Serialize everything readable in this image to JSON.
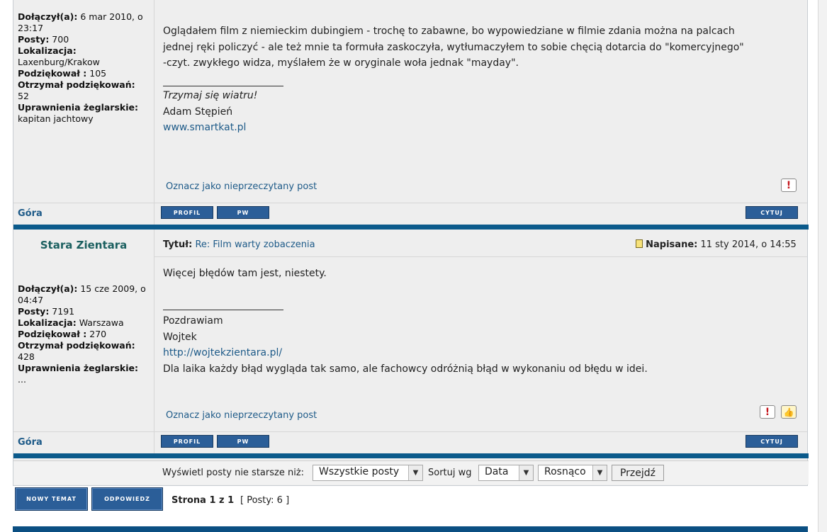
{
  "post1": {
    "profile": {
      "joined_label": "Dołączył(a):",
      "joined_value": "6 mar 2010, o 23:17",
      "posts_label": "Posty:",
      "posts_value": "700",
      "location_label": "Lokalizacja:",
      "location_value": "Laxenburg/Krakow",
      "thanked_label": "Podziękował :",
      "thanked_value": "105",
      "received_label": "Otrzymał podziękowań:",
      "received_value": "52",
      "rights_label": "Uprawnienia żeglarskie:",
      "rights_value": "kapitan jachtowy"
    },
    "body_lines": [
      "Oglądałem film z niemieckim dubingiem - trochę to zabawne, bo wypowiedziane w filmie zdania można na palcach",
      "jednej ręki policzyć - ale też mnie ta formuła zaskoczyła, wytłumaczyłem to sobie chęcią dotarcia do \"komercyjnego\"",
      "-czyt. zwykłego widza, myślałem że w oryginale woła jednak \"mayday\"."
    ],
    "sig_italic": "Trzymaj się wiatru!",
    "sig_name": "Adam Stępień",
    "sig_link": "www.smartkat.pl",
    "mark_unread": "Oznacz jako nieprzeczytany post",
    "top_link": "Góra",
    "btn_profile": "Profil",
    "btn_pm": "PW",
    "btn_quote": "Cytuj"
  },
  "post2": {
    "username": "Stara Zientara",
    "title_label": "Tytuł:",
    "title_value": "Re: Film warty zobaczenia",
    "posted_label": "Napisane:",
    "posted_value": "11 sty 2014, o 14:55",
    "profile": {
      "joined_label": "Dołączył(a):",
      "joined_value": "15 cze 2009, o 04:47",
      "posts_label": "Posty:",
      "posts_value": "7191",
      "location_label": "Lokalizacja:",
      "location_value": "Warszawa",
      "thanked_label": "Podziękował :",
      "thanked_value": "270",
      "received_label": "Otrzymał podziękowań:",
      "received_value": "428",
      "rights_label": "Uprawnienia żeglarskie:",
      "rights_value": "..."
    },
    "body": "Więcej błędów tam jest, niestety.",
    "sig_greet": "Pozdrawiam",
    "sig_name": "Wojtek",
    "sig_link": "http://wojtekzientara.pl/",
    "sig_quote": "Dla laika każdy błąd wygląda tak samo, ale fachowcy odróżnią błąd w wykonaniu od błędu w idei.",
    "mark_unread": "Oznacz jako nieprzeczytany post",
    "top_link": "Góra",
    "btn_profile": "Profil",
    "btn_pm": "PW",
    "btn_quote": "Cytuj"
  },
  "filter": {
    "show_label": "Wyświetl posty nie starsze niż:",
    "show_value": "Wszystkie posty",
    "sort_label": "Sortuj wg",
    "sort_value": "Data",
    "order_value": "Rosnąco",
    "go_label": "Przejdź"
  },
  "footer": {
    "new_topic": "Nowy temat",
    "reply": "Odpowiedz",
    "page_info": "Strona 1 z 1",
    "posts_info": "[ Posty: 6 ]"
  },
  "icons": {
    "report": "report-icon",
    "thanks": "thumbs-up-icon",
    "post": "post-icon",
    "dropdown": "chevron-down-icon"
  },
  "colors": {
    "accent": "#0b5a8b",
    "button": "#2b5e98",
    "link": "#1d5a88",
    "username": "#1c6060"
  }
}
